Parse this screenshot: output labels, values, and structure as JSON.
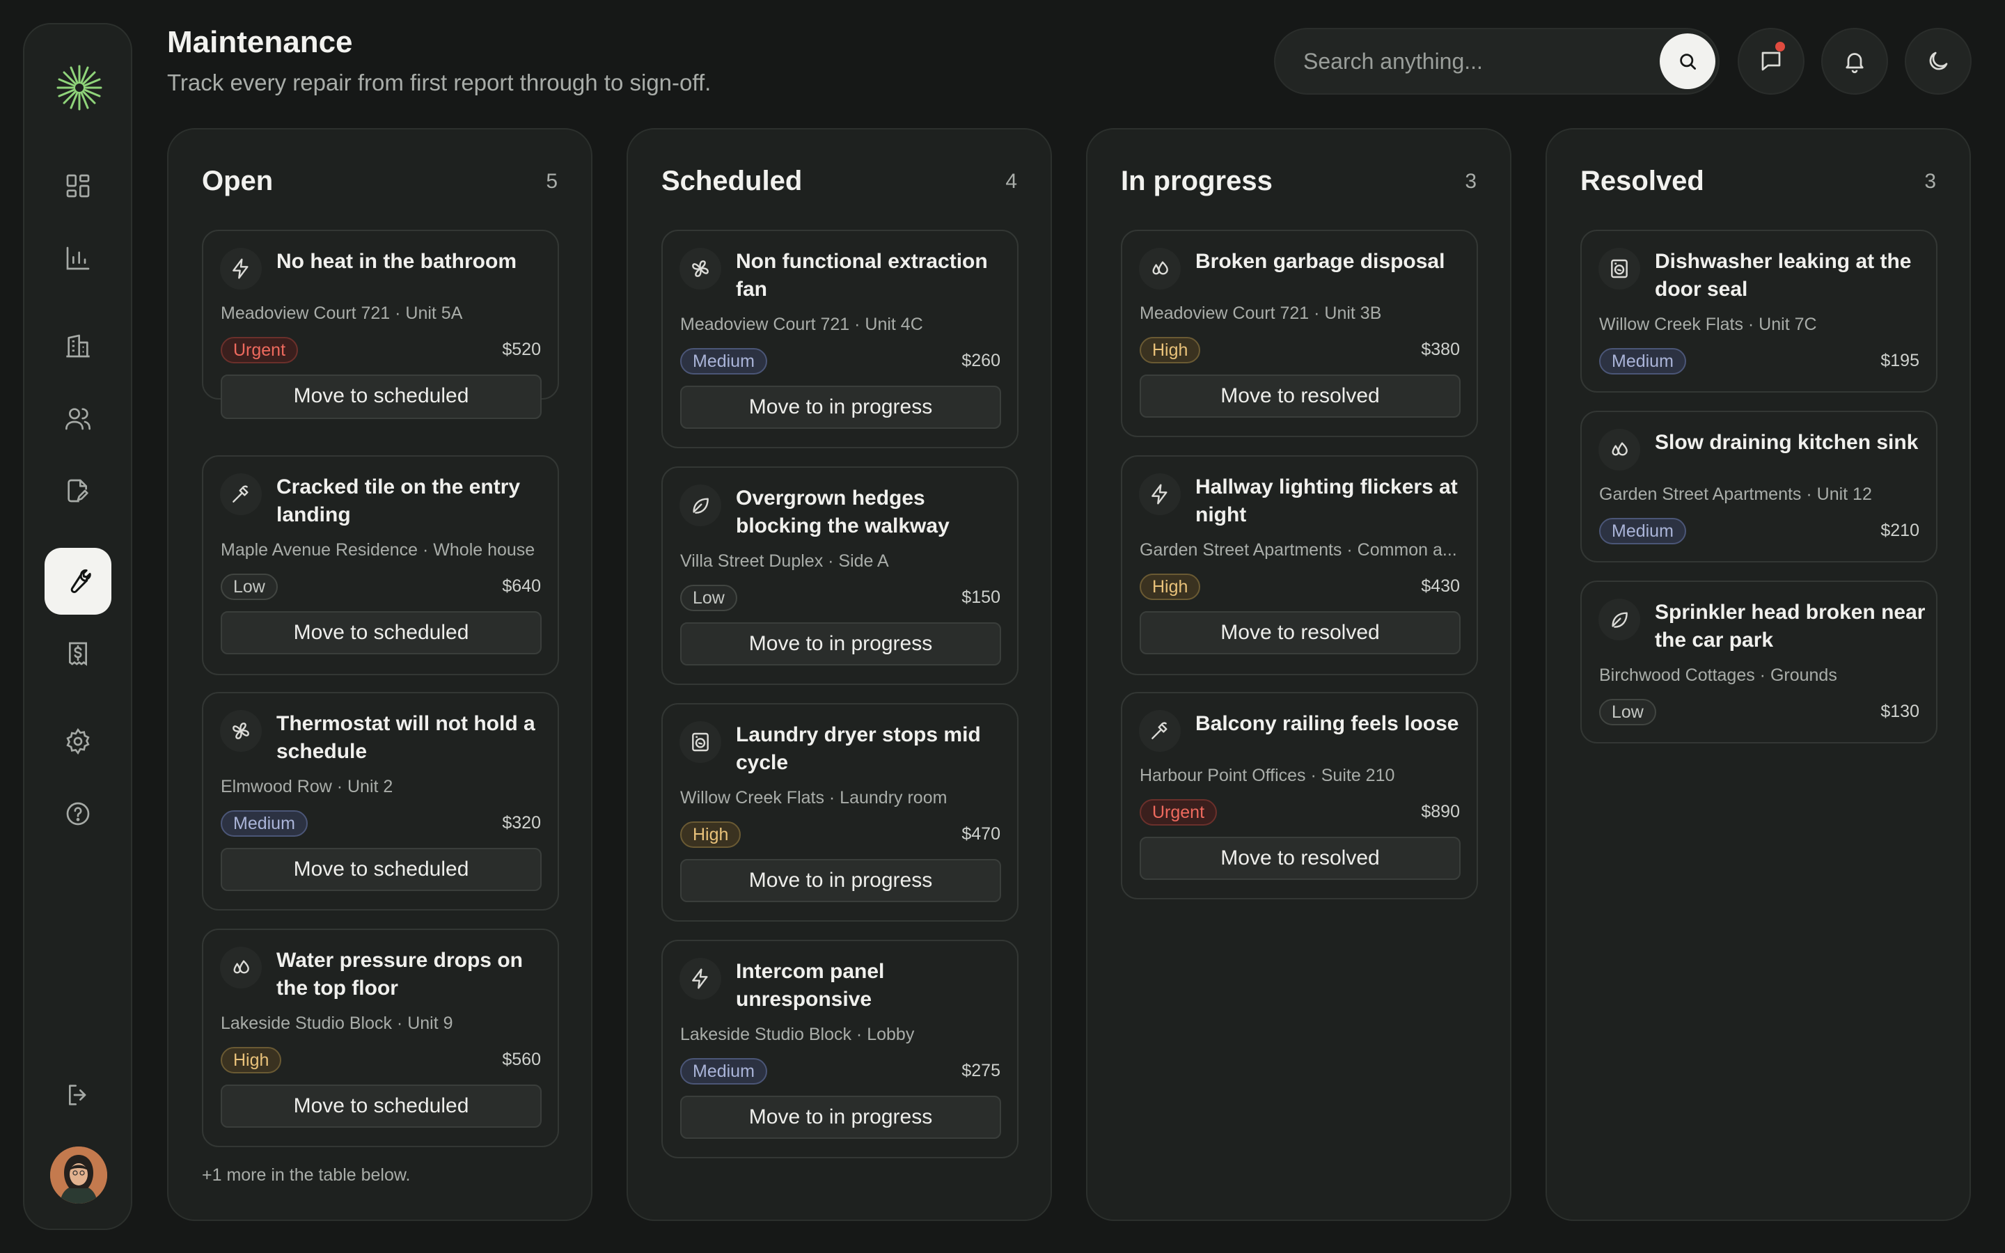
{
  "header": {
    "title": "Maintenance",
    "subtitle": "Track every repair from first report through to sign-off.",
    "search_placeholder": "Search anything..."
  },
  "sidebar": {
    "items": [
      {
        "icon": "dashboard-icon"
      },
      {
        "icon": "chart-icon"
      },
      {
        "icon": "building-icon"
      },
      {
        "icon": "users-icon"
      },
      {
        "icon": "document-edit-icon"
      },
      {
        "icon": "wrench-icon",
        "active": true
      },
      {
        "icon": "invoice-dollar-icon"
      },
      {
        "icon": "gear-icon"
      },
      {
        "icon": "help-icon"
      },
      {
        "icon": "logout-icon"
      }
    ]
  },
  "columns": [
    {
      "title": "Open",
      "count": "5",
      "cards": [
        {
          "icon": "lightning-icon",
          "title": "No heat in the bathroom",
          "location": "Meadoview Court 721 · Unit 5A",
          "priority": "Urgent",
          "cost": "$520",
          "action": "Move to scheduled"
        },
        {
          "icon": "hammer-icon",
          "title": "Cracked tile on the entry landing",
          "location": "Maple Avenue Residence · Whole house",
          "priority": "Low",
          "cost": "$640",
          "action": "Move to scheduled"
        },
        {
          "icon": "fan-icon",
          "title": "Thermostat will not hold a schedule",
          "location": "Elmwood Row · Unit 2",
          "priority": "Medium",
          "cost": "$320",
          "action": "Move to scheduled"
        },
        {
          "icon": "droplets-icon",
          "title": "Water pressure drops on the top floor",
          "location": "Lakeside Studio Block · Unit 9",
          "priority": "High",
          "cost": "$560",
          "action": "Move to scheduled"
        }
      ],
      "more": "+1 more in the table below."
    },
    {
      "title": "Scheduled",
      "count": "4",
      "cards": [
        {
          "icon": "fan-icon",
          "title": "Non functional extraction fan",
          "location": "Meadoview Court 721 · Unit 4C",
          "priority": "Medium",
          "cost": "$260",
          "action": "Move to in progress"
        },
        {
          "icon": "leaf-icon",
          "title": "Overgrown hedges blocking the walkway",
          "location": "Villa Street Duplex · Side A",
          "priority": "Low",
          "cost": "$150",
          "action": "Move to in progress"
        },
        {
          "icon": "washing-machine-icon",
          "title": "Laundry dryer stops mid cycle",
          "location": "Willow Creek Flats · Laundry room",
          "priority": "High",
          "cost": "$470",
          "action": "Move to in progress"
        },
        {
          "icon": "lightning-icon",
          "title": "Intercom panel unresponsive",
          "location": "Lakeside Studio Block · Lobby",
          "priority": "Medium",
          "cost": "$275",
          "action": "Move to in progress"
        }
      ]
    },
    {
      "title": "In progress",
      "count": "3",
      "cards": [
        {
          "icon": "droplets-icon",
          "title": "Broken garbage disposal",
          "location": "Meadoview Court 721 · Unit 3B",
          "priority": "High",
          "cost": "$380",
          "action": "Move to resolved"
        },
        {
          "icon": "lightning-icon",
          "title": "Hallway lighting flickers at night",
          "location": "Garden Street Apartments · Common a...",
          "priority": "High",
          "cost": "$430",
          "action": "Move to resolved"
        },
        {
          "icon": "hammer-icon",
          "title": "Balcony railing feels loose",
          "location": "Harbour Point Offices · Suite 210",
          "priority": "Urgent",
          "cost": "$890",
          "action": "Move to resolved"
        }
      ]
    },
    {
      "title": "Resolved",
      "count": "3",
      "cards": [
        {
          "icon": "washing-machine-icon",
          "title": "Dishwasher leaking at the door seal",
          "location": "Willow Creek Flats · Unit 7C",
          "priority": "Medium",
          "cost": "$195"
        },
        {
          "icon": "droplets-icon",
          "title": "Slow draining kitchen sink",
          "location": "Garden Street Apartments · Unit 12",
          "priority": "Medium",
          "cost": "$210"
        },
        {
          "icon": "leaf-icon",
          "title": "Sprinkler head broken near the car park",
          "location": "Birchwood Cottages · Grounds",
          "priority": "Low",
          "cost": "$130"
        }
      ]
    }
  ]
}
